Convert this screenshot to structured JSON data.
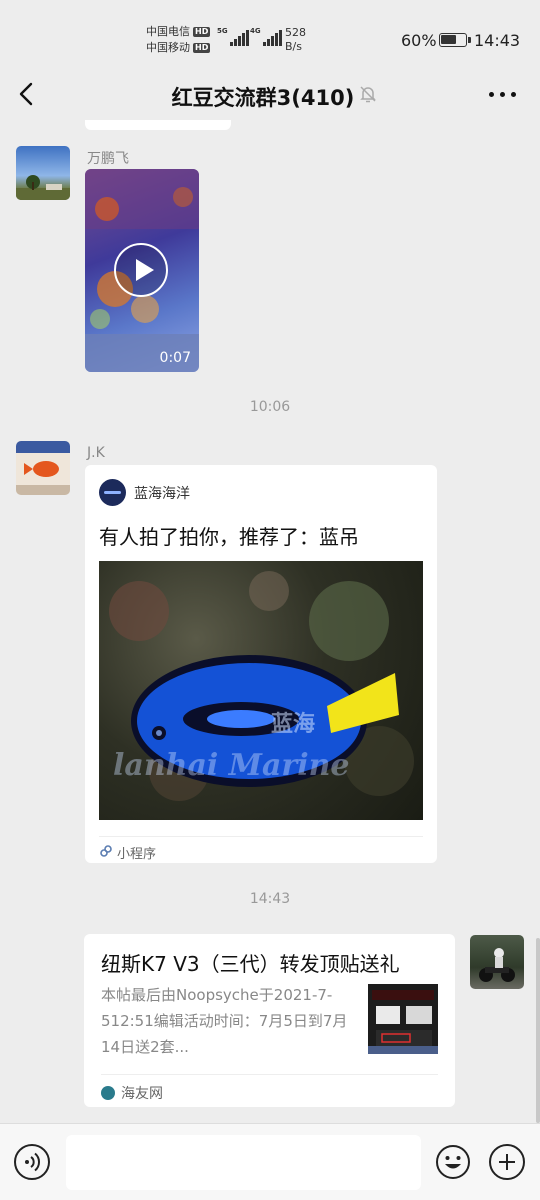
{
  "status_bar": {
    "carrier_1": "中国电信",
    "carrier_2": "中国移动",
    "hd_badge": "HD",
    "net_1": "5G",
    "net_2": "4G",
    "speed_value": "528",
    "speed_unit": "B/s",
    "battery_percent": "60%",
    "time": "14:43"
  },
  "header": {
    "title": "红豆交流群3(410)",
    "back_icon": "chevron-left-icon",
    "mute_icon": "bell-off-icon",
    "more_icon": "more-dots-icon"
  },
  "messages": [
    {
      "type": "video",
      "sender": "万鹏飞",
      "duration": "0:07"
    },
    {
      "type": "time",
      "text": "10:06"
    },
    {
      "type": "mini_program",
      "sender": "J.K",
      "app_name": "蓝海海洋",
      "title": "有人拍了拍你，推荐了：蓝吊",
      "footer": "小程序",
      "image_watermark": "蓝海",
      "image_watermark_en": "lanhai Marine"
    },
    {
      "type": "time",
      "text": "14:43"
    },
    {
      "type": "link",
      "title": "纽斯K7 V3（三代）转发顶贴送礼",
      "desc": "本帖最后由Noopsyche于2021-7-512:51编辑活动时间：7月5日到7月14日送2套...",
      "source": "海友网"
    }
  ],
  "input_bar": {
    "voice_icon": "voice-icon",
    "emoji_icon": "emoji-icon",
    "plus_icon": "plus-icon"
  },
  "colors": {
    "background": "#ededed",
    "bubble": "#ffffff",
    "meta_text": "#888888"
  }
}
